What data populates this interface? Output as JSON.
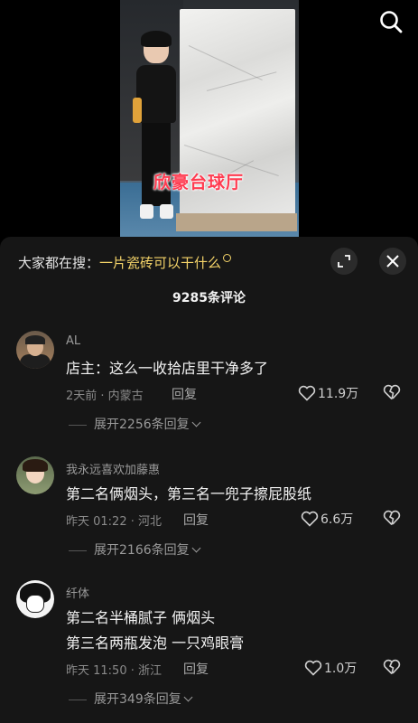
{
  "video": {
    "caption": "欣豪台球厅"
  },
  "panel": {
    "trending_prefix": "大家都在搜：",
    "trending_term": "一片瓷砖可以干什么",
    "comment_count": "9285条评论"
  },
  "comments": [
    {
      "user": "AL",
      "text": "店主：这么一收拾店里干净多了",
      "meta": "2天前 · 内蒙古",
      "reply_label": "回复",
      "likes": "11.9万",
      "expand_label": "展开2256条回复"
    },
    {
      "user": "我永远喜欢加藤惠",
      "text": "第二名俩烟头，第三名一兜子擦屁股纸",
      "meta": "昨天 01:22 · 河北",
      "reply_label": "回复",
      "likes": "6.6万",
      "expand_label": "展开2166条回复"
    },
    {
      "user": "纤体",
      "text_line1": "第二名半桶腻子 俩烟头",
      "text_line2": "第三名两瓶发泡 一只鸡眼膏",
      "meta": "昨天 11:50 · 浙江",
      "reply_label": "回复",
      "likes": "1.0万",
      "expand_label": "展开349条回复"
    }
  ],
  "icons": {
    "search": "search-icon",
    "expand": "expand-icon",
    "close": "close-icon",
    "like": "heart-icon",
    "dislike": "broken-heart-icon",
    "chevron": "chevron-down-icon"
  },
  "colors": {
    "panel_bg": "#161616",
    "highlight": "#f5d469",
    "caption": "#ff3b50"
  }
}
